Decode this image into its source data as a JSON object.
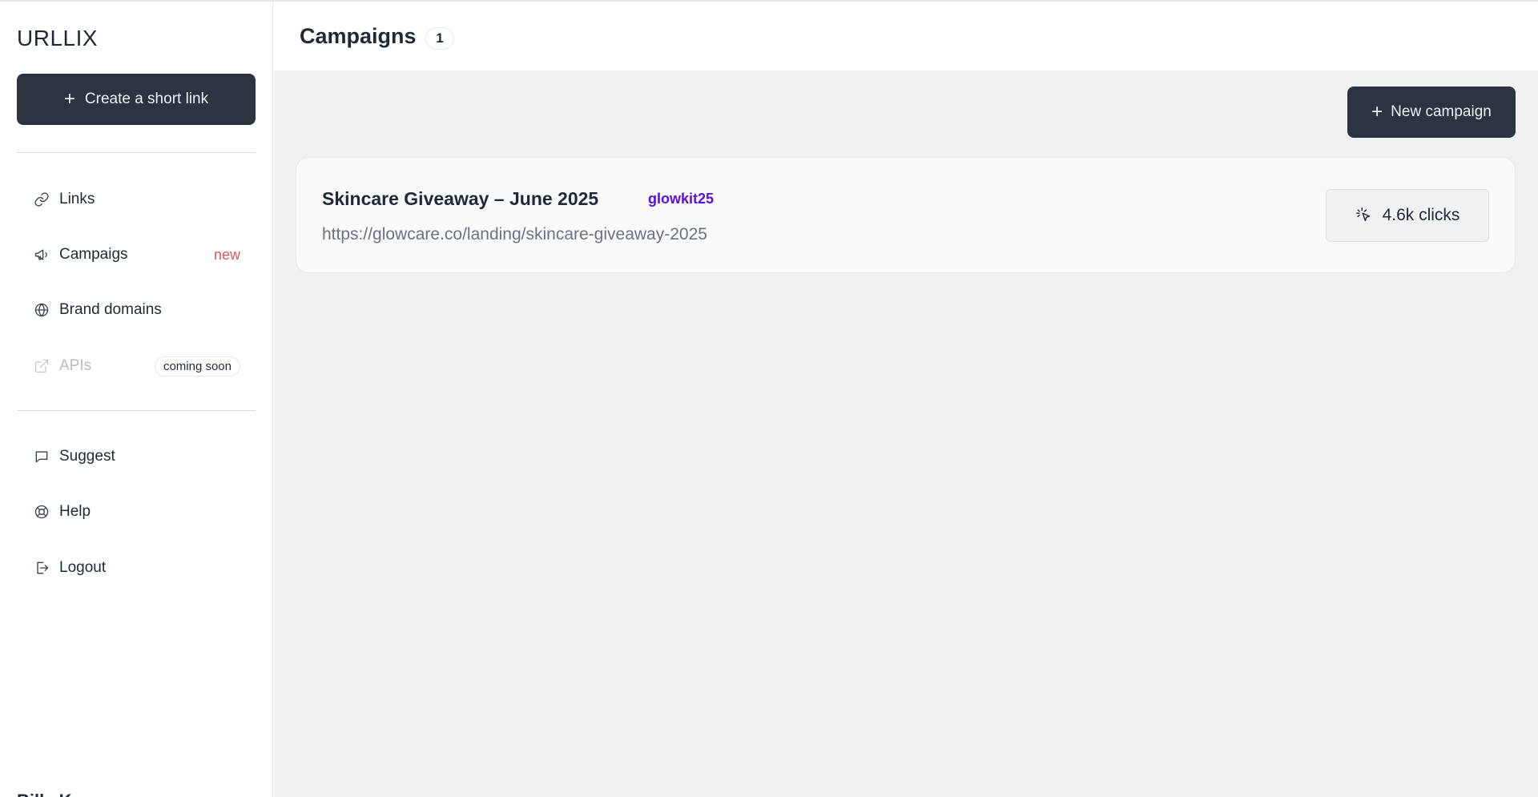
{
  "sidebar": {
    "logo": "URLLIX",
    "create_button_label": "Create a short link",
    "nav": [
      {
        "label": "Links",
        "icon": "link-icon"
      },
      {
        "label": "Campaigs",
        "icon": "megaphone-icon",
        "badge": "new"
      },
      {
        "label": "Brand domains",
        "icon": "globe-icon"
      },
      {
        "label": "APIs",
        "icon": "external-link-icon",
        "badge": "coming soon",
        "disabled": true
      }
    ],
    "secondary_nav": [
      {
        "label": "Suggest",
        "icon": "message-icon"
      },
      {
        "label": "Help",
        "icon": "lifebuoy-icon"
      },
      {
        "label": "Logout",
        "icon": "logout-icon"
      }
    ],
    "user_name": "Billy K"
  },
  "header": {
    "title": "Campaigns",
    "count": "1"
  },
  "toolbar": {
    "new_campaign_label": "New campaign"
  },
  "campaigns": [
    {
      "title": "Skincare Giveaway – June 2025",
      "code": "glowkit25",
      "url": "https://glowcare.co/landing/skincare-giveaway-2025",
      "clicks": "4.6k clicks"
    }
  ],
  "colors": {
    "primary_button": "#2d3340",
    "accent_code": "#5b0fe0",
    "badge_new": "#e25555",
    "main_background": "#f1f1f1"
  }
}
